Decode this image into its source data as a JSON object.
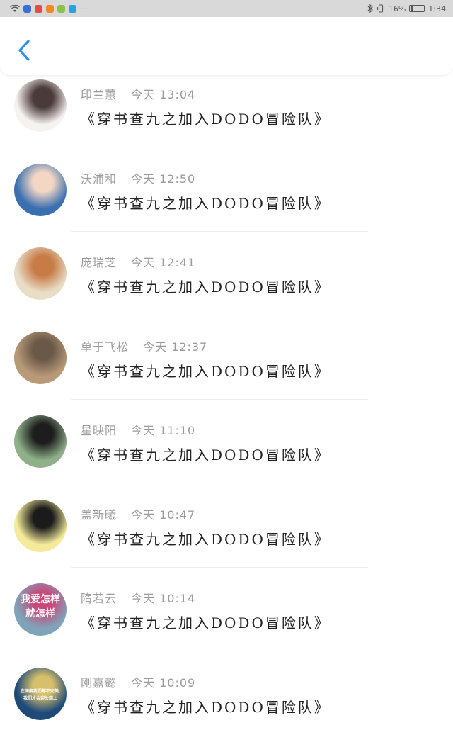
{
  "status_bar": {
    "battery": "16%",
    "battery_level": 0.16,
    "time": "1:34",
    "app_icons": [
      {
        "name": "app-icon-blue",
        "color": "#3b6fd6"
      },
      {
        "name": "app-icon-red",
        "color": "#e54d42"
      },
      {
        "name": "app-icon-orange",
        "color": "#f08a24"
      },
      {
        "name": "app-icon-green",
        "color": "#8bc34a"
      },
      {
        "name": "app-icon-cyan",
        "color": "#29a3e0"
      }
    ],
    "more": "···"
  },
  "header": {
    "back_icon": "chevron-left-icon",
    "accent": "#2b8fe8"
  },
  "items": [
    {
      "name": "印兰蕙",
      "time": "今天 13:04",
      "message": "《穿书查九之加入DODO冒险队》",
      "avatar_colors": [
        "#f5f2ef",
        "#4a3a3a"
      ]
    },
    {
      "name": "沃浦和",
      "time": "今天 12:50",
      "message": "《穿书查九之加入DODO冒险队》",
      "avatar_colors": [
        "#3a6fb0",
        "#f3d7c4"
      ]
    },
    {
      "name": "庞瑞芝",
      "time": "今天 12:41",
      "message": "《穿书查九之加入DODO冒险队》",
      "avatar_colors": [
        "#e8ddc7",
        "#c77b45"
      ]
    },
    {
      "name": "单于飞松",
      "time": "今天 12:37",
      "message": "《穿书查九之加入DODO冒险队》",
      "avatar_colors": [
        "#b89a78",
        "#6a5848"
      ]
    },
    {
      "name": "星映阳",
      "time": "今天 11:10",
      "message": "《穿书查九之加入DODO冒险队》",
      "avatar_colors": [
        "#8fb08a",
        "#1d1d1d"
      ]
    },
    {
      "name": "盖新曦",
      "time": "今天 10:47",
      "message": "《穿书查九之加入DODO冒险队》",
      "avatar_colors": [
        "#f4ea9a",
        "#1b1b1b"
      ]
    },
    {
      "name": "隋若云",
      "time": "今天 10:14",
      "message": "《穿书查九之加入DODO冒险队》",
      "avatar_colors": [
        "#7fa3b8",
        "#c84a7a"
      ],
      "avatar_text": [
        "我爱怎样",
        "就怎样"
      ]
    },
    {
      "name": "刚嘉懿",
      "time": "今天 10:09",
      "message": "《穿书查九之加入DODO冒险队》",
      "avatar_colors": [
        "#1e4a7a",
        "#d7c06a"
      ],
      "avatar_text": [
        "在国度我们都不完美,",
        "我们才会迎头而上"
      ]
    }
  ]
}
